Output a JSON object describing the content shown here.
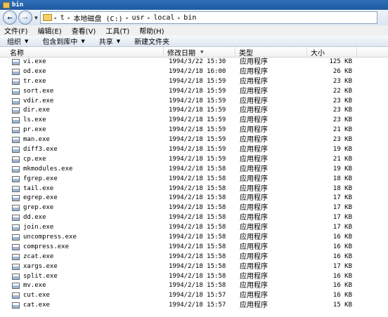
{
  "window": {
    "title": "bin"
  },
  "nav": {
    "back_glyph": "←",
    "forward_glyph": "→",
    "address": [
      {
        "label": "t"
      },
      {
        "label": "本地磁盘 (C:)"
      },
      {
        "label": "usr"
      },
      {
        "label": "local"
      },
      {
        "label": "bin"
      }
    ]
  },
  "menu": {
    "file": "文件(F)",
    "edit": "编辑(E)",
    "view": "查看(V)",
    "tools": "工具(T)",
    "help": "帮助(H)"
  },
  "toolbar": {
    "organize": "组织",
    "include_in_library": "包含到库中",
    "share": "共享",
    "new_folder": "新建文件夹"
  },
  "columns": {
    "name": "名称",
    "date": "修改日期",
    "type": "类型",
    "size": "大小"
  },
  "files": [
    {
      "name": "vi.exe",
      "date": "1994/3/22 15:30",
      "type": "应用程序",
      "size": "125 KB"
    },
    {
      "name": "od.exe",
      "date": "1994/2/18 16:00",
      "type": "应用程序",
      "size": "26 KB"
    },
    {
      "name": "tr.exe",
      "date": "1994/2/18 15:59",
      "type": "应用程序",
      "size": "23 KB"
    },
    {
      "name": "sort.exe",
      "date": "1994/2/18 15:59",
      "type": "应用程序",
      "size": "22 KB"
    },
    {
      "name": "vdir.exe",
      "date": "1994/2/18 15:59",
      "type": "应用程序",
      "size": "23 KB"
    },
    {
      "name": "dir.exe",
      "date": "1994/2/18 15:59",
      "type": "应用程序",
      "size": "23 KB"
    },
    {
      "name": "ls.exe",
      "date": "1994/2/18 15:59",
      "type": "应用程序",
      "size": "23 KB"
    },
    {
      "name": "pr.exe",
      "date": "1994/2/18 15:59",
      "type": "应用程序",
      "size": "21 KB"
    },
    {
      "name": "man.exe",
      "date": "1994/2/18 15:59",
      "type": "应用程序",
      "size": "23 KB"
    },
    {
      "name": "diff3.exe",
      "date": "1994/2/18 15:59",
      "type": "应用程序",
      "size": "19 KB"
    },
    {
      "name": "cp.exe",
      "date": "1994/2/18 15:59",
      "type": "应用程序",
      "size": "21 KB"
    },
    {
      "name": "mkmodules.exe",
      "date": "1994/2/18 15:58",
      "type": "应用程序",
      "size": "19 KB"
    },
    {
      "name": "fgrep.exe",
      "date": "1994/2/18 15:58",
      "type": "应用程序",
      "size": "18 KB"
    },
    {
      "name": "tail.exe",
      "date": "1994/2/18 15:58",
      "type": "应用程序",
      "size": "18 KB"
    },
    {
      "name": "egrep.exe",
      "date": "1994/2/18 15:58",
      "type": "应用程序",
      "size": "17 KB"
    },
    {
      "name": "grep.exe",
      "date": "1994/2/18 15:58",
      "type": "应用程序",
      "size": "17 KB"
    },
    {
      "name": "dd.exe",
      "date": "1994/2/18 15:58",
      "type": "应用程序",
      "size": "17 KB"
    },
    {
      "name": "join.exe",
      "date": "1994/2/18 15:58",
      "type": "应用程序",
      "size": "17 KB"
    },
    {
      "name": "uncompress.exe",
      "date": "1994/2/18 15:58",
      "type": "应用程序",
      "size": "16 KB"
    },
    {
      "name": "compress.exe",
      "date": "1994/2/18 15:58",
      "type": "应用程序",
      "size": "16 KB"
    },
    {
      "name": "zcat.exe",
      "date": "1994/2/18 15:58",
      "type": "应用程序",
      "size": "16 KB"
    },
    {
      "name": "xargs.exe",
      "date": "1994/2/18 15:58",
      "type": "应用程序",
      "size": "17 KB"
    },
    {
      "name": "split.exe",
      "date": "1994/2/18 15:58",
      "type": "应用程序",
      "size": "16 KB"
    },
    {
      "name": "mv.exe",
      "date": "1994/2/18 15:58",
      "type": "应用程序",
      "size": "16 KB"
    },
    {
      "name": "cut.exe",
      "date": "1994/2/18 15:57",
      "type": "应用程序",
      "size": "16 KB"
    },
    {
      "name": "cat.exe",
      "date": "1994/2/18 15:57",
      "type": "应用程序",
      "size": "15 KB"
    }
  ]
}
